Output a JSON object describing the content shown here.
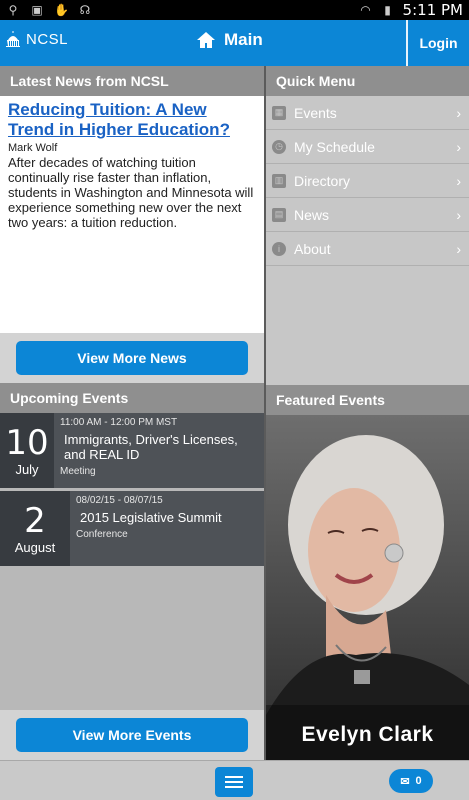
{
  "status_bar": {
    "time": "5:11 PM",
    "left_icons": [
      "usb-icon",
      "clipboard-check-icon",
      "hand-icon",
      "headphones-icon"
    ],
    "right_icons": [
      "wifi-icon",
      "battery-icon"
    ]
  },
  "app_bar": {
    "logo_text": "NCSL",
    "title": "Main",
    "login_label": "Login"
  },
  "news": {
    "header": "Latest News from NCSL",
    "title": "Reducing Tuition: A New Trend in Higher Education?",
    "author": "Mark Wolf",
    "summary": "After decades of watching tuition continually rise faster than inflation, students in Washington and Minnesota will experience something new over the next two years: a tuition reduction.",
    "more_label": "View More News"
  },
  "events": {
    "header": "Upcoming Events",
    "items": [
      {
        "day": "10",
        "month": "July",
        "time": "11:00 AM - 12:00 PM MST",
        "name": "Immigrants, Driver's Licenses, and REAL ID",
        "type": "Meeting"
      },
      {
        "day": "2",
        "month": "August",
        "time": "08/02/15 - 08/07/15",
        "name": "2015 Legislative Summit",
        "type": "Conference"
      }
    ],
    "more_label": "View More Events"
  },
  "quick_menu": {
    "header": "Quick Menu",
    "items": [
      {
        "label": "Events",
        "icon": "calendar-icon"
      },
      {
        "label": "My Schedule",
        "icon": "clock-icon"
      },
      {
        "label": "Directory",
        "icon": "book-icon"
      },
      {
        "label": "News",
        "icon": "newspaper-icon"
      },
      {
        "label": "About",
        "icon": "info-icon"
      }
    ]
  },
  "featured": {
    "header": "Featured Events",
    "name": "Evelyn Clark"
  },
  "bottom_bar": {
    "messages_count": "0"
  },
  "colors": {
    "accent": "#0c86d6",
    "link": "#1a62c4",
    "event_bg": "#4e5257",
    "date_bg": "#373b40",
    "header_gray": "#8f8f8f"
  }
}
